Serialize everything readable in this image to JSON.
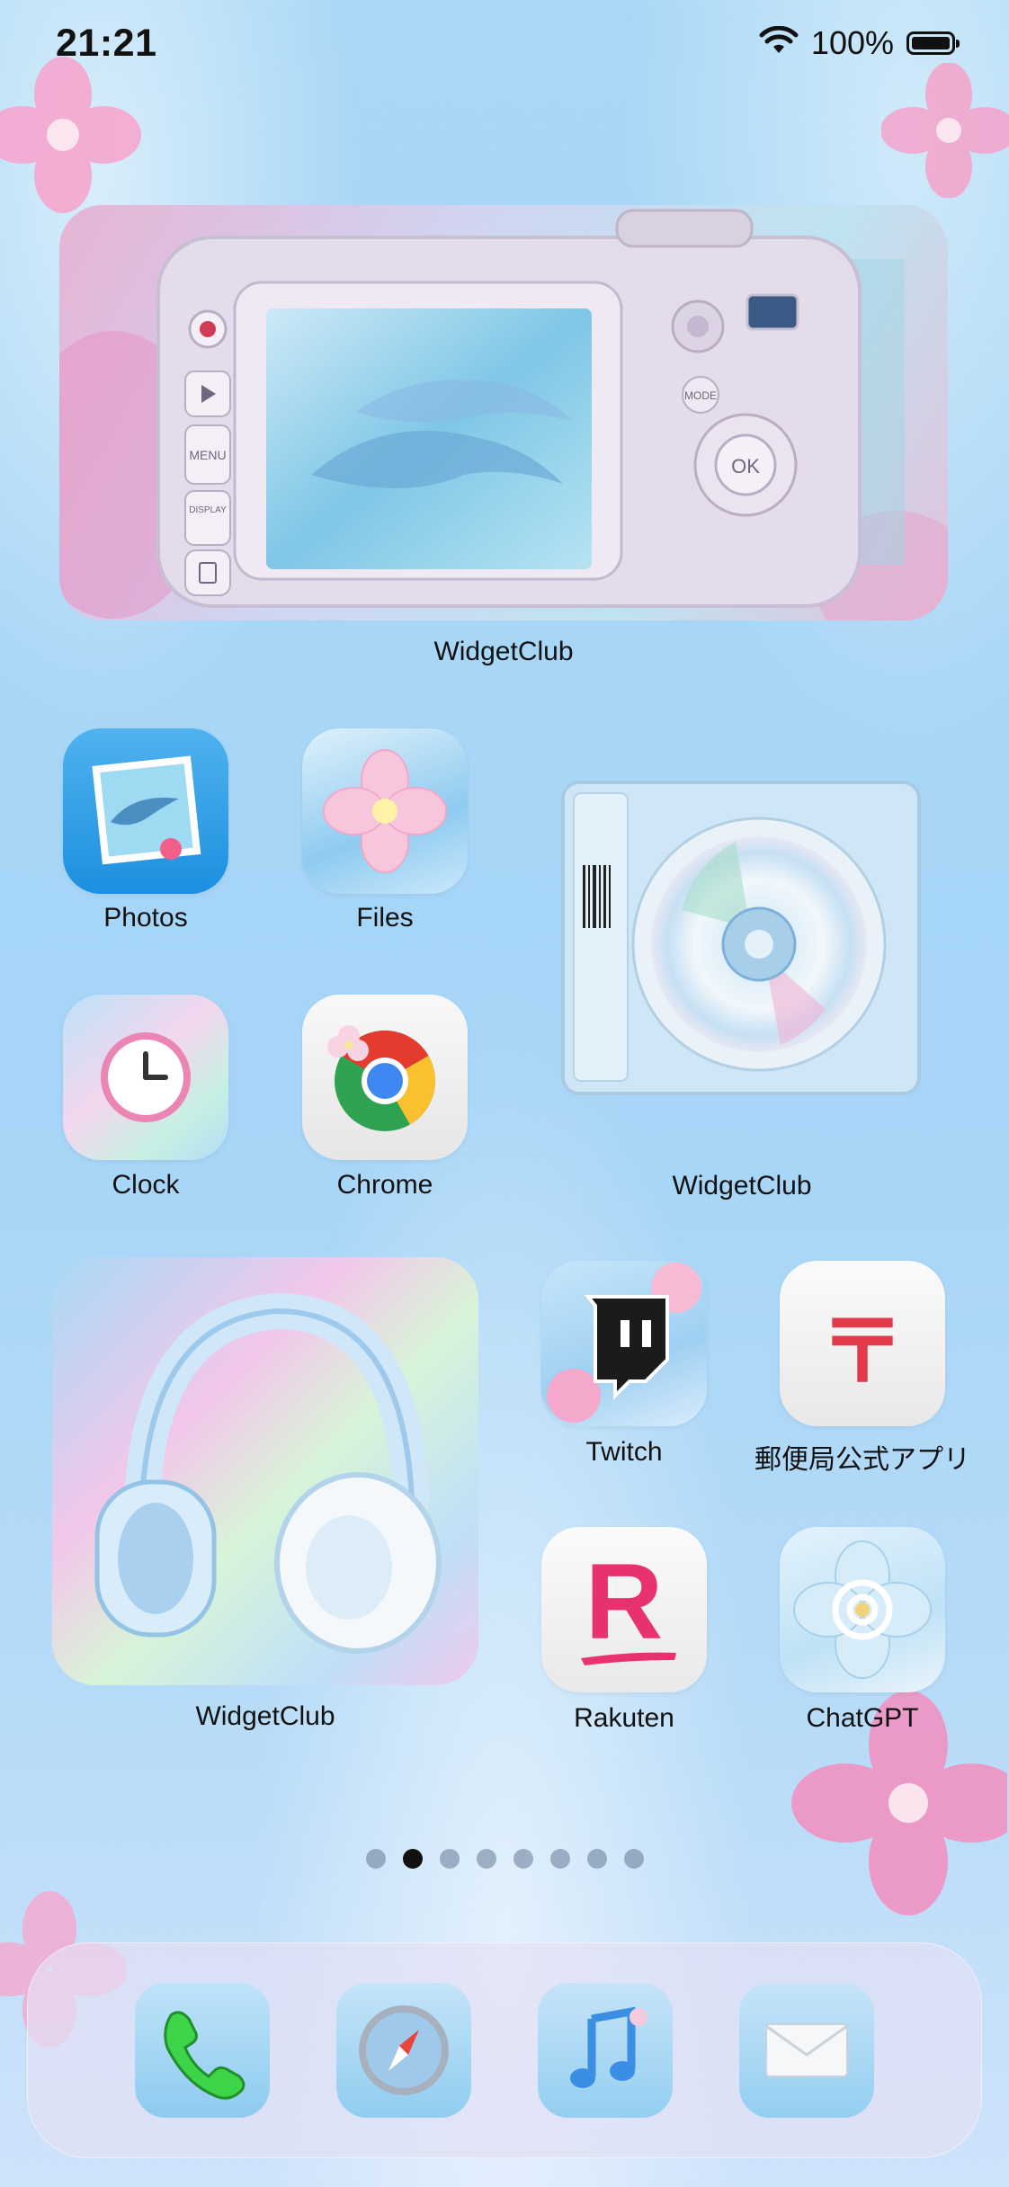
{
  "status_bar": {
    "time": "21:21",
    "battery_percent": "100%"
  },
  "widgets": {
    "camera": {
      "label": "WidgetClub"
    },
    "cd": {
      "label": "WidgetClub"
    },
    "headphones": {
      "label": "WidgetClub"
    }
  },
  "apps": {
    "photos": "Photos",
    "files": "Files",
    "clock": "Clock",
    "chrome": "Chrome",
    "twitch": "Twitch",
    "post": "郵便局公式アプリ",
    "rakuten": "Rakuten",
    "chatgpt": "ChatGPT"
  },
  "page_dots": {
    "count": 8,
    "active_index": 1
  },
  "dock": {
    "icons": [
      "phone-icon",
      "safari-icon",
      "music-icon",
      "mail-icon"
    ]
  },
  "icon_text": {
    "camera_menu": "MENU",
    "camera_display": "DISPLAY",
    "camera_mode": "MODE",
    "camera_ok": "OK",
    "rakuten_letter": "R",
    "post_mark": "〒"
  }
}
